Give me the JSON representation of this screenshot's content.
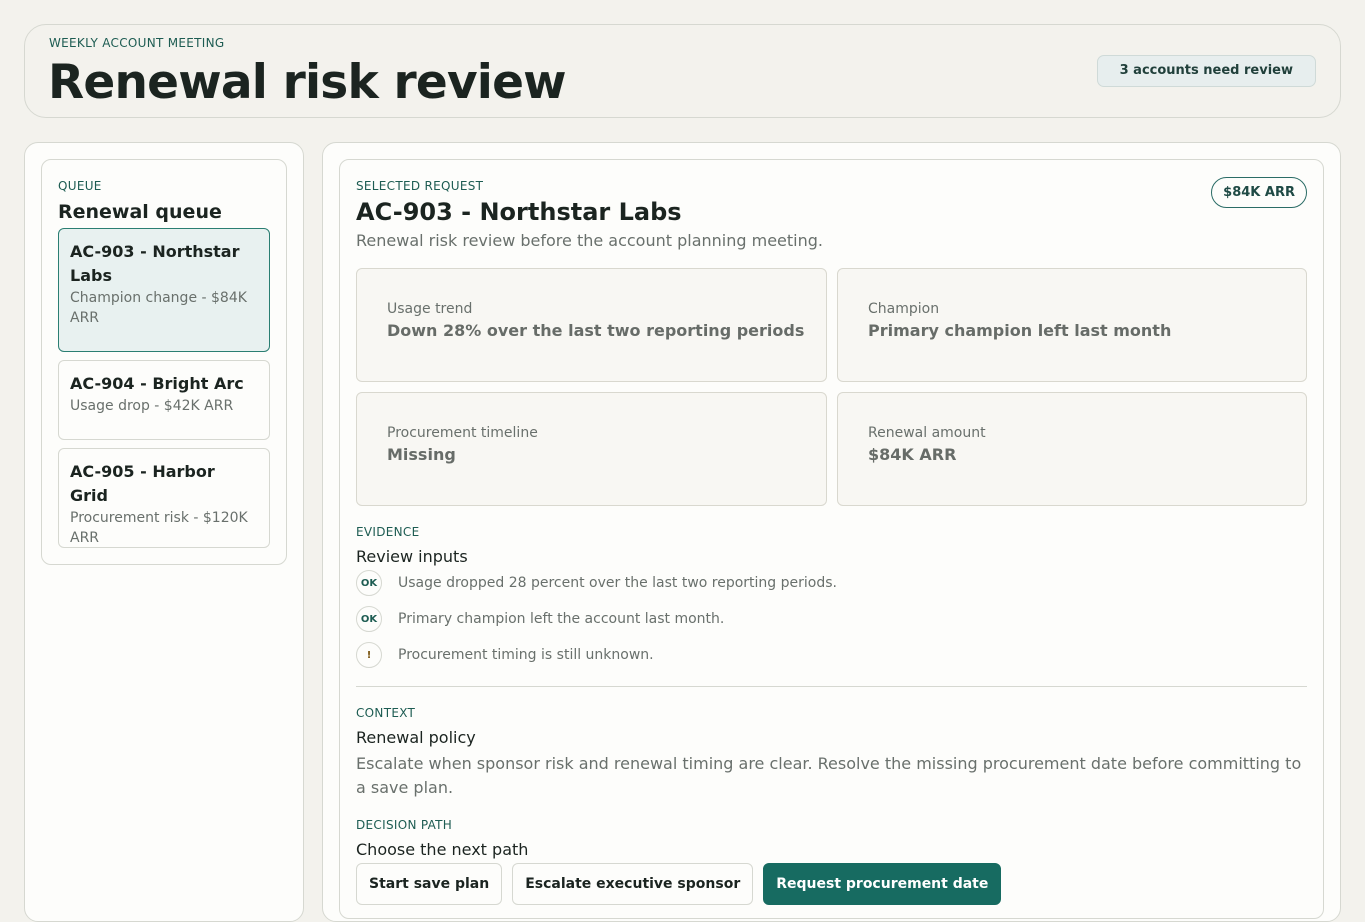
{
  "header": {
    "eyebrow": "WEEKLY ACCOUNT MEETING",
    "title": "Renewal risk review",
    "review_badge": "3 accounts need review"
  },
  "queue": {
    "eyebrow": "QUEUE",
    "title": "Renewal queue",
    "items": [
      {
        "title": "AC-903 - Northstar Labs",
        "subtitle": "Champion change - $84K ARR",
        "selected": true
      },
      {
        "title": "AC-904 - Bright Arc",
        "subtitle": "Usage drop - $42K ARR",
        "selected": false
      },
      {
        "title": "AC-905 - Harbor Grid",
        "subtitle": "Procurement risk - $120K ARR",
        "selected": false
      }
    ]
  },
  "detail": {
    "eyebrow": "SELECTED REQUEST",
    "title": "AC-903 - Northstar Labs",
    "description": "Renewal risk review before the account planning meeting.",
    "arr_badge": "$84K ARR",
    "metrics": [
      {
        "label": "Usage trend",
        "value": "Down 28% over the last two reporting periods"
      },
      {
        "label": "Champion",
        "value": "Primary champion left last month"
      },
      {
        "label": "Procurement timeline",
        "value": "Missing"
      },
      {
        "label": "Renewal amount",
        "value": "$84K ARR"
      }
    ],
    "evidence": {
      "eyebrow": "EVIDENCE",
      "title": "Review inputs",
      "items": [
        {
          "badge": "OK",
          "icon": "check-badge-icon",
          "text": "Usage dropped 28 percent over the last two reporting periods."
        },
        {
          "badge": "OK",
          "icon": "check-badge-icon",
          "text": "Primary champion left the account last month."
        },
        {
          "badge": "!",
          "icon": "warning-badge-icon",
          "text": "Procurement timing is still unknown."
        }
      ]
    },
    "context": {
      "eyebrow": "CONTEXT",
      "title": "Renewal policy",
      "text": "Escalate when sponsor risk and renewal timing are clear. Resolve the missing procurement date before committing to a save plan."
    },
    "decision": {
      "eyebrow": "DECISION PATH",
      "title": "Choose the next path",
      "buttons": {
        "save_plan": "Start save plan",
        "escalate": "Escalate executive sponsor",
        "request_date": "Request procurement date"
      }
    }
  },
  "colors": {
    "background": "#f3f2ed",
    "accent": "#176b61",
    "selected_item_bg": "#e8f1f0",
    "selected_item_border": "#2a7e72",
    "eyebrow_text": "#1d5c52"
  }
}
